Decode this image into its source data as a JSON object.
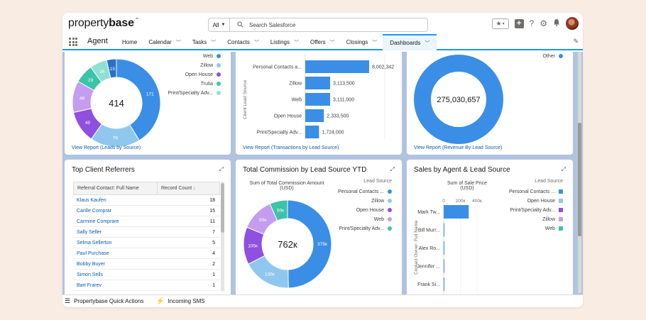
{
  "header": {
    "logo_plain": "property",
    "logo_bold": "base",
    "search_scope": "All",
    "search_placeholder": "Search Salesforce"
  },
  "nav": {
    "app_name": "Agent",
    "items": [
      {
        "label": "Home",
        "chevron": false
      },
      {
        "label": "Calendar",
        "chevron": true
      },
      {
        "label": "Tasks",
        "chevron": true
      },
      {
        "label": "Contacts",
        "chevron": true
      },
      {
        "label": "Listings",
        "chevron": true
      },
      {
        "label": "Offers",
        "chevron": true
      },
      {
        "label": "Closings",
        "chevron": true
      },
      {
        "label": "Dashboards",
        "chevron": true,
        "active": true
      }
    ]
  },
  "colors": {
    "accent": "#1b96ff",
    "series_blue": "#3a8ee6",
    "series_light_blue": "#90c7ef",
    "series_purple": "#8f4fe0",
    "series_lilac": "#c49cf0",
    "series_teal": "#3dc3a8"
  },
  "cards": {
    "leads_by_source": {
      "view_report": "View Report (Leads by Source)",
      "center_value": "414",
      "chart_data": {
        "type": "pie",
        "slices": [
          {
            "label": "Web",
            "value": 171,
            "color": "#3a8ee6"
          },
          {
            "label": "Zillow",
            "value": 76,
            "color": "#90c7ef"
          },
          {
            "label": "Open House",
            "value": 49,
            "color": "#8f4fe0"
          },
          {
            "label": "Trulia",
            "value": 48,
            "color": "#c49cf0"
          },
          {
            "label": "Print/Specialty Adv...",
            "value": 29,
            "color": "#3dc3a8"
          },
          {
            "label": "",
            "value": 26,
            "color": "#90e0d2"
          },
          {
            "label": "",
            "value": 15,
            "color": "#2a70c8"
          }
        ],
        "legend": [
          {
            "label": "Web",
            "color": "#3a8ee6"
          },
          {
            "label": "Zillow",
            "color": "#90c7ef"
          },
          {
            "label": "Open House",
            "color": "#8f4fe0"
          },
          {
            "label": "Trulia",
            "color": "#3dc3a8"
          },
          {
            "label": "Print/Specialty Adv...",
            "color": "#90e0d2"
          }
        ]
      }
    },
    "transactions_by_lead_source": {
      "view_report": "View Report (Transactions by Lead Source)",
      "chart_data": {
        "type": "bar",
        "ylabel": "Client Lead Source",
        "categories": [
          "Personal Contacts a...",
          "Zillow",
          "Web",
          "Open House",
          "Print/Specialty Adv..."
        ],
        "values": [
          8002342,
          3113500,
          3111000,
          2333500,
          1724000
        ],
        "value_labels": [
          "8,002,342",
          "3,113,500",
          "3,111,000",
          "2,333,500",
          "1,724,000"
        ],
        "color": "#3a8ee6"
      }
    },
    "revenue_by_lead_source": {
      "view_report": "View Report (Revenue By Lead Source)",
      "center_value": "275,030,657",
      "chart_data": {
        "type": "pie",
        "slices": [
          {
            "label": "",
            "value": 264,
            "color": "#3a8ee6"
          }
        ],
        "slice_label": "264м",
        "legend": [
          {
            "label": "Other",
            "color": "#3a8ee6"
          }
        ]
      }
    },
    "top_client_referrers": {
      "title": "Top Client Referrers",
      "col1": "Referral Contact: Full Name",
      "col2": "Record Count",
      "sort_indicator": "↓",
      "rows": [
        {
          "name": "Klaus Kaufen",
          "count": "18"
        },
        {
          "name": "Carille Comprar",
          "count": "15"
        },
        {
          "name": "Carmine Comprare",
          "count": "11"
        },
        {
          "name": "Sally Seller",
          "count": "7"
        },
        {
          "name": "Selma Sellerton",
          "count": "5"
        },
        {
          "name": "Paul Purchase",
          "count": "4"
        },
        {
          "name": "Bobby Buyer",
          "count": "2"
        },
        {
          "name": "Simon Sells",
          "count": "1"
        },
        {
          "name": "Bart Frarev",
          "count": "1"
        }
      ]
    },
    "total_commission": {
      "title": "Total Commission by Lead Source YTD",
      "center_value": "762к",
      "chart_data": {
        "type": "pie",
        "title": "Sum of Total Commission Amount (USD)",
        "legend_title": "Lead Source",
        "slices": [
          {
            "label": "Personal Contacts ...",
            "value": 379,
            "text": "379к",
            "color": "#3a8ee6"
          },
          {
            "label": "Zillow",
            "value": 136,
            "text": "136к",
            "color": "#90c7ef"
          },
          {
            "label": "Open House",
            "value": 105,
            "text": "105к",
            "color": "#8f4fe0"
          },
          {
            "label": "Web",
            "value": 93,
            "text": "93к",
            "color": "#c49cf0"
          },
          {
            "label": "Print/Specialty Adv...",
            "value": 50,
            "text": "50к",
            "color": "#3dc3a8"
          }
        ]
      }
    },
    "sales_by_agent": {
      "title": "Sales by Agent & Lead Source",
      "chart_data": {
        "type": "bar",
        "title": "Sum of Sale Price (USD)",
        "ylabel": "Contact Owner: Full Name",
        "legend_title": "Lead Source",
        "x_ticks": [
          "0",
          "200к",
          "400к"
        ],
        "categories": [
          "Mark Tw...",
          "Bill Murr...",
          "Alex Ro...",
          "Jennifer ...",
          "Frank Si..."
        ],
        "values": [
          300,
          3,
          3,
          3,
          3
        ],
        "legend": [
          {
            "label": "Personal Contacts ...",
            "color": "#3a8ee6"
          },
          {
            "label": "Open House",
            "color": "#90c7ef"
          },
          {
            "label": "Print/Specialty Adv...",
            "color": "#8f4fe0"
          },
          {
            "label": "Zillow",
            "color": "#c49cf0"
          },
          {
            "label": "Web",
            "color": "#3dc3a8"
          }
        ]
      }
    }
  },
  "utility_bar": {
    "quick_actions": "Propertybase Quick Actions",
    "incoming_sms": "Incoming SMS"
  }
}
